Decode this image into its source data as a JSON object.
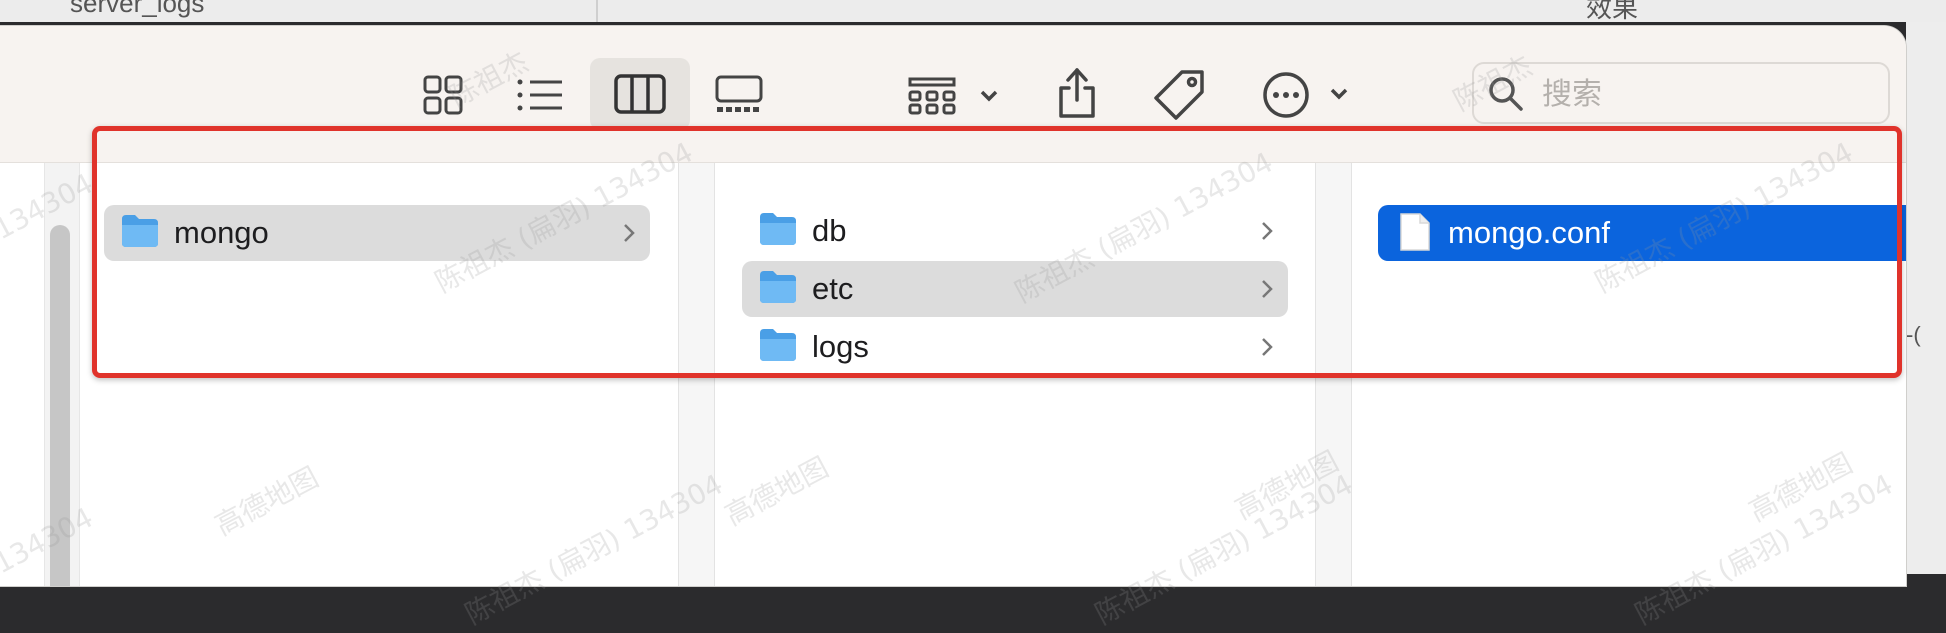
{
  "background": {
    "left_window_text": "server_logs",
    "right_window_text": "效果",
    "right_edge_text": "-("
  },
  "toolbar": {
    "view_icon_names": [
      "grid-view-icon",
      "list-view-icon",
      "column-view-icon",
      "gallery-view-icon"
    ],
    "group_icon": "group-by-icon",
    "share_icon": "share-icon",
    "tag_icon": "tag-icon",
    "more_icon": "more-actions-icon",
    "search_placeholder": "搜索"
  },
  "columns": [
    {
      "items": [
        {
          "label": "mongo",
          "type": "folder",
          "has_children": true,
          "state": "selected-inactive"
        }
      ]
    },
    {
      "items": [
        {
          "label": "db",
          "type": "folder",
          "has_children": true,
          "state": "none"
        },
        {
          "label": "etc",
          "type": "folder",
          "has_children": true,
          "state": "selected-inactive"
        },
        {
          "label": "logs",
          "type": "folder",
          "has_children": true,
          "state": "none"
        }
      ]
    },
    {
      "items": [
        {
          "label": "mongo.conf",
          "type": "file",
          "has_children": false,
          "state": "selected-active"
        }
      ]
    }
  ],
  "watermark": {
    "name": "陈祖杰",
    "full": "陈祖杰 (扁羽) 134304",
    "id": "134304",
    "company": "高德地图"
  },
  "colors": {
    "selection_blue": "#0b64dd",
    "selection_gray": "#dcdcdc",
    "annotation_red": "#e0332b",
    "folder_blue": "#5aaef0"
  }
}
